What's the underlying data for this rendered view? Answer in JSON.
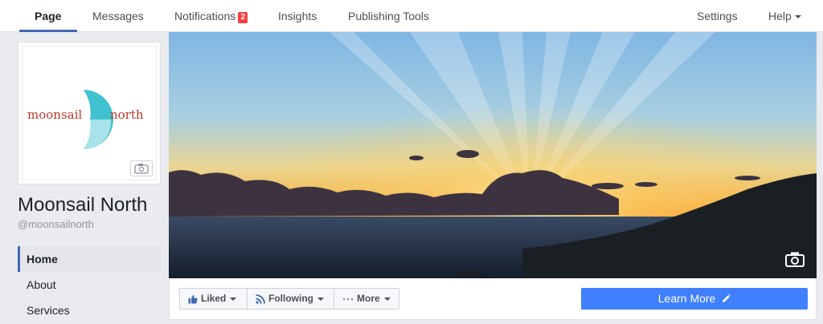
{
  "topnav": {
    "tabs": [
      {
        "label": "Page",
        "active": true
      },
      {
        "label": "Messages"
      },
      {
        "label": "Notifications",
        "badge": "2"
      },
      {
        "label": "Insights"
      },
      {
        "label": "Publishing Tools"
      }
    ],
    "settings": "Settings",
    "help": "Help"
  },
  "profile": {
    "logo_text_left": "moonsail",
    "logo_text_right": "north",
    "name": "Moonsail North",
    "handle": "@moonsailnorth",
    "camera_icon": "camera-icon"
  },
  "sidebar": {
    "items": [
      {
        "label": "Home",
        "active": true
      },
      {
        "label": "About"
      },
      {
        "label": "Services"
      }
    ]
  },
  "actions": {
    "liked": "Liked",
    "following": "Following",
    "more": "More",
    "learn_more": "Learn More"
  },
  "colors": {
    "brand_blue": "#4267b2",
    "cta_blue": "#4080ff",
    "badge_red": "#fa3e3e",
    "logo_red": "#c0392b",
    "logo_teal": "#3fc1d0"
  }
}
